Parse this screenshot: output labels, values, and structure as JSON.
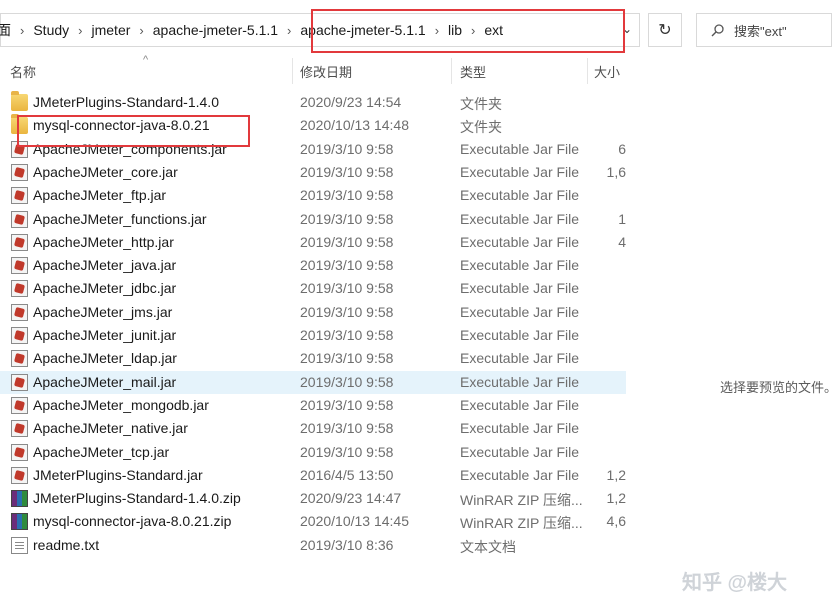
{
  "breadcrumb": [
    "面",
    "Study",
    "jmeter",
    "apache-jmeter-5.1.1",
    "apache-jmeter-5.1.1",
    "lib",
    "ext"
  ],
  "toolbar": {
    "refresh_icon": "↻",
    "dropdown_icon": "⌄"
  },
  "search": {
    "placeholder": "搜索\"ext\"",
    "icon": "search-icon"
  },
  "columns": {
    "name": "名称",
    "date": "修改日期",
    "type": "类型",
    "size": "大小"
  },
  "files": [
    {
      "name": "JMeterPlugins-Standard-1.4.0",
      "date": "2020/9/23 14:54",
      "type": "文件夹",
      "size": "",
      "icon": "folder"
    },
    {
      "name": "mysql-connector-java-8.0.21",
      "date": "2020/10/13 14:48",
      "type": "文件夹",
      "size": "",
      "icon": "folder"
    },
    {
      "name": "ApacheJMeter_components.jar",
      "date": "2019/3/10 9:58",
      "type": "Executable Jar File",
      "size": "6",
      "icon": "jar"
    },
    {
      "name": "ApacheJMeter_core.jar",
      "date": "2019/3/10 9:58",
      "type": "Executable Jar File",
      "size": "1,6",
      "icon": "jar"
    },
    {
      "name": "ApacheJMeter_ftp.jar",
      "date": "2019/3/10 9:58",
      "type": "Executable Jar File",
      "size": "",
      "icon": "jar"
    },
    {
      "name": "ApacheJMeter_functions.jar",
      "date": "2019/3/10 9:58",
      "type": "Executable Jar File",
      "size": "1",
      "icon": "jar"
    },
    {
      "name": "ApacheJMeter_http.jar",
      "date": "2019/3/10 9:58",
      "type": "Executable Jar File",
      "size": "4",
      "icon": "jar"
    },
    {
      "name": "ApacheJMeter_java.jar",
      "date": "2019/3/10 9:58",
      "type": "Executable Jar File",
      "size": "",
      "icon": "jar"
    },
    {
      "name": "ApacheJMeter_jdbc.jar",
      "date": "2019/3/10 9:58",
      "type": "Executable Jar File",
      "size": "",
      "icon": "jar"
    },
    {
      "name": "ApacheJMeter_jms.jar",
      "date": "2019/3/10 9:58",
      "type": "Executable Jar File",
      "size": "",
      "icon": "jar"
    },
    {
      "name": "ApacheJMeter_junit.jar",
      "date": "2019/3/10 9:58",
      "type": "Executable Jar File",
      "size": "",
      "icon": "jar"
    },
    {
      "name": "ApacheJMeter_ldap.jar",
      "date": "2019/3/10 9:58",
      "type": "Executable Jar File",
      "size": "",
      "icon": "jar"
    },
    {
      "name": "ApacheJMeter_mail.jar",
      "date": "2019/3/10 9:58",
      "type": "Executable Jar File",
      "size": "",
      "icon": "jar",
      "selected": true
    },
    {
      "name": "ApacheJMeter_mongodb.jar",
      "date": "2019/3/10 9:58",
      "type": "Executable Jar File",
      "size": "",
      "icon": "jar"
    },
    {
      "name": "ApacheJMeter_native.jar",
      "date": "2019/3/10 9:58",
      "type": "Executable Jar File",
      "size": "",
      "icon": "jar"
    },
    {
      "name": "ApacheJMeter_tcp.jar",
      "date": "2019/3/10 9:58",
      "type": "Executable Jar File",
      "size": "",
      "icon": "jar"
    },
    {
      "name": "JMeterPlugins-Standard.jar",
      "date": "2016/4/5 13:50",
      "type": "Executable Jar File",
      "size": "1,2",
      "icon": "jar"
    },
    {
      "name": "JMeterPlugins-Standard-1.4.0.zip",
      "date": "2020/9/23 14:47",
      "type": "WinRAR ZIP 压缩...",
      "size": "1,2",
      "icon": "zip"
    },
    {
      "name": "mysql-connector-java-8.0.21.zip",
      "date": "2020/10/13 14:45",
      "type": "WinRAR ZIP 压缩...",
      "size": "4,6",
      "icon": "zip"
    },
    {
      "name": "readme.txt",
      "date": "2019/3/10 8:36",
      "type": "文本文档",
      "size": "",
      "icon": "txt"
    }
  ],
  "preview": {
    "message": "选择要预览的文件。"
  },
  "watermark": {
    "text": "知乎 @楼大"
  },
  "colors": {
    "highlight": "#e2393c",
    "selected_row": "#e5f3fb"
  }
}
